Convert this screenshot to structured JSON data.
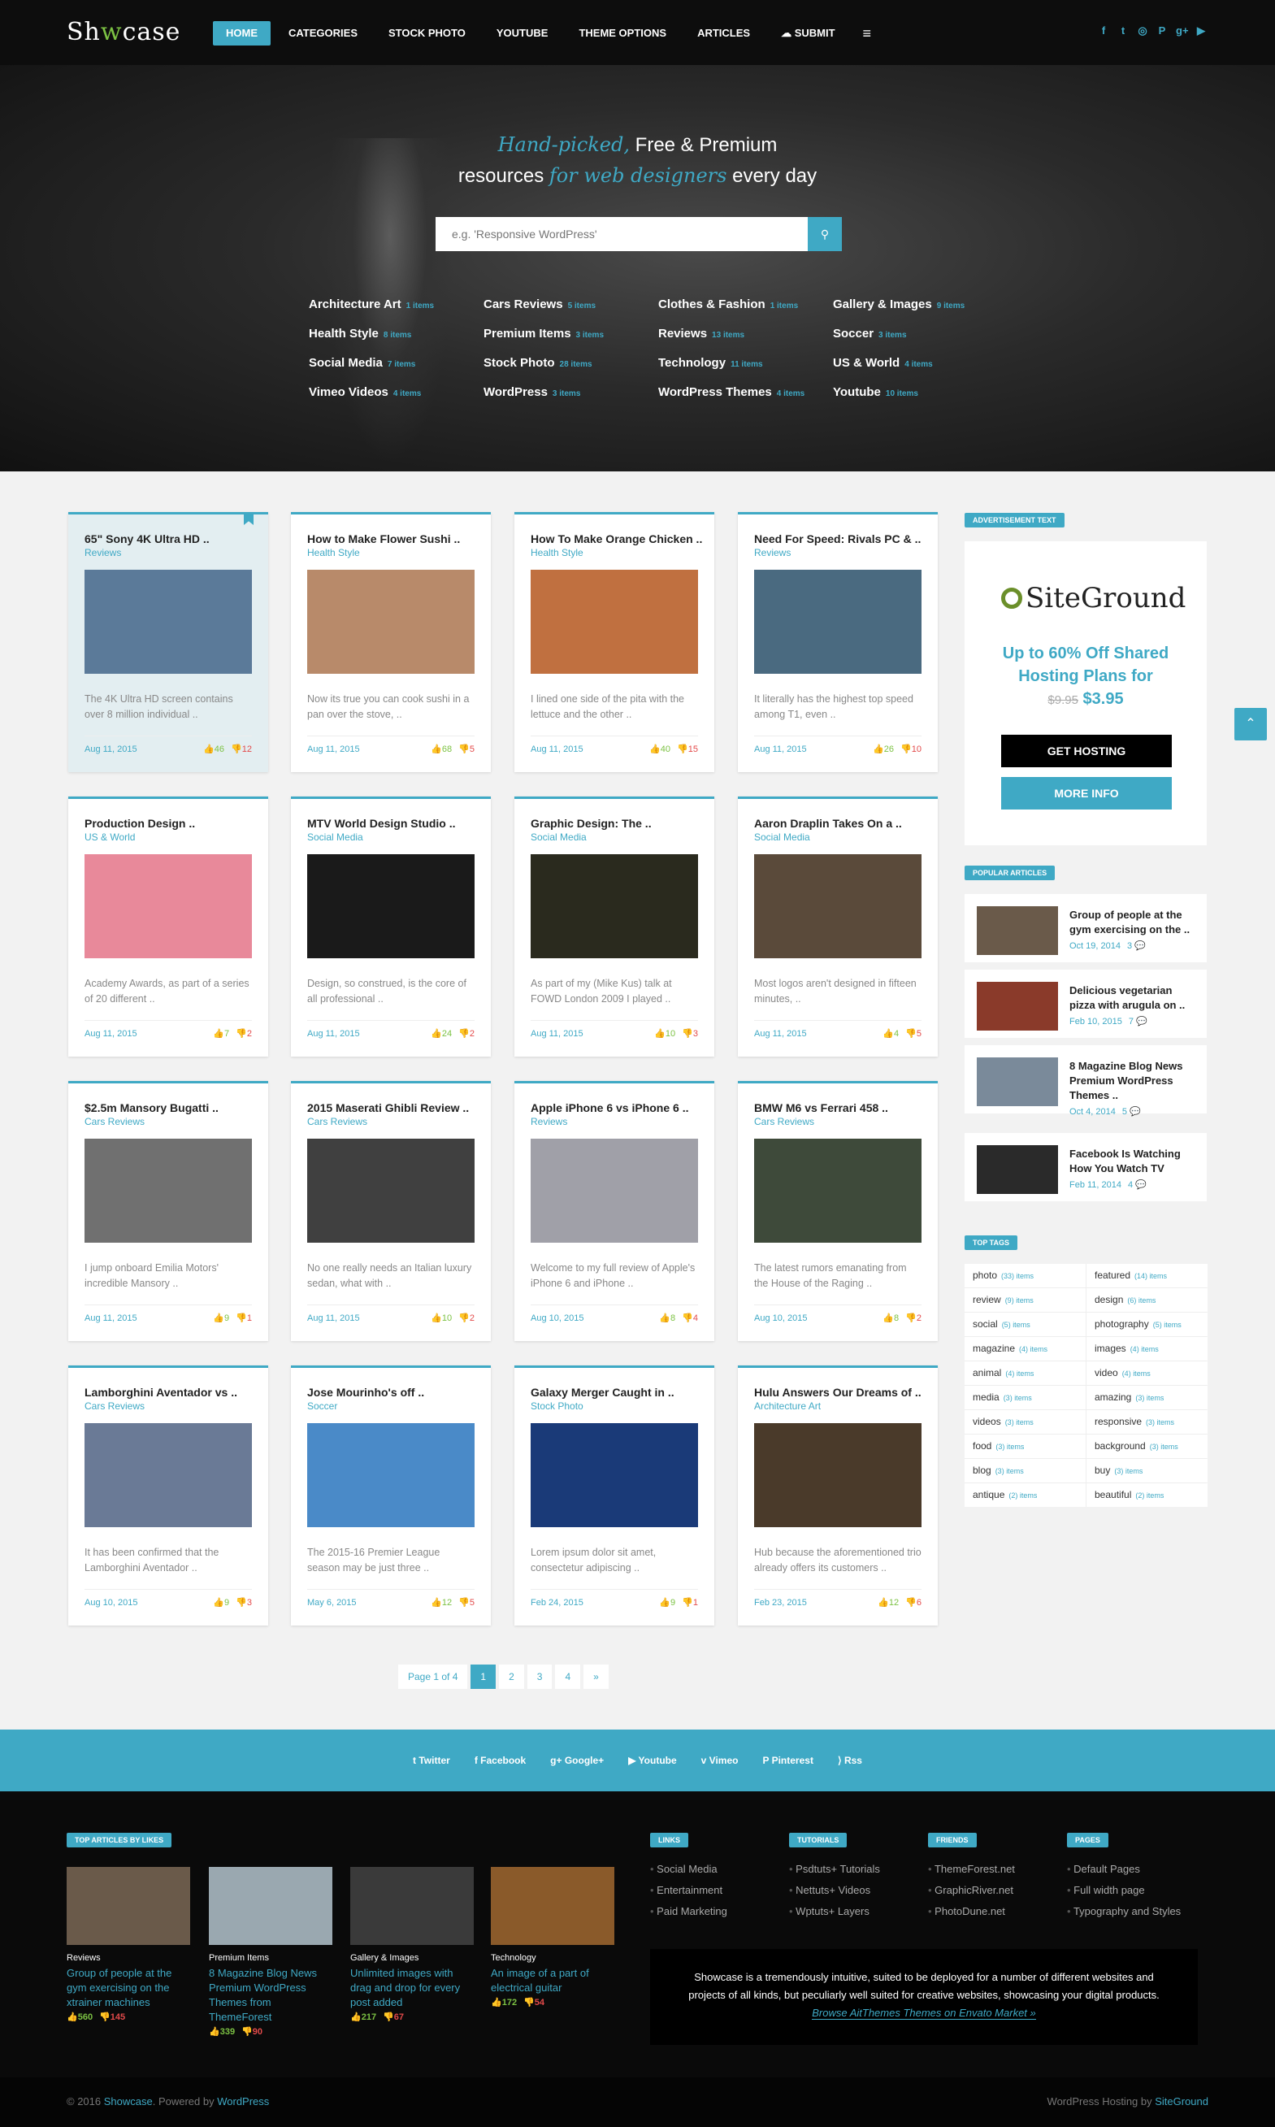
{
  "header": {
    "logo_pre": "Sh",
    "logo_w": "w",
    "logo_post": "case",
    "nav": [
      "HOME",
      "CATEGORIES",
      "STOCK PHOTO",
      "YOUTUBE",
      "THEME OPTIONS",
      "ARTICLES",
      "SUBMIT"
    ],
    "social_icons": [
      "facebook-icon",
      "twitter-icon",
      "instagram-icon",
      "pinterest-icon",
      "google-plus-icon",
      "youtube-icon"
    ]
  },
  "hero": {
    "line1_hl": "Hand-picked,",
    "line1": " Free & Premium",
    "line2_a": "resources ",
    "line2_hl": "for web designers",
    "line2_b": " every day",
    "search_placeholder": "e.g. 'Responsive WordPress'",
    "categories": [
      {
        "name": "Architecture Art",
        "count": "1 items"
      },
      {
        "name": "Cars Reviews",
        "count": "5 items"
      },
      {
        "name": "Clothes & Fashion",
        "count": "1 items"
      },
      {
        "name": "Gallery & Images",
        "count": "9 items"
      },
      {
        "name": "Health Style",
        "count": "8 items"
      },
      {
        "name": "Premium Items",
        "count": "3 items"
      },
      {
        "name": "Reviews",
        "count": "13 items"
      },
      {
        "name": "Soccer",
        "count": "3 items"
      },
      {
        "name": "Social Media",
        "count": "7 items"
      },
      {
        "name": "Stock Photo",
        "count": "28 items"
      },
      {
        "name": "Technology",
        "count": "11 items"
      },
      {
        "name": "US & World",
        "count": "4 items"
      },
      {
        "name": "Vimeo Videos",
        "count": "4 items"
      },
      {
        "name": "WordPress",
        "count": "3 items"
      },
      {
        "name": "WordPress Themes",
        "count": "4 items"
      },
      {
        "name": "Youtube",
        "count": "10 items"
      }
    ]
  },
  "posts": [
    {
      "title": "65\" Sony 4K Ultra HD ..",
      "cat": "Reviews",
      "excerpt": "The 4K Ultra HD screen contains over 8 million individual ..",
      "date": "Aug 11, 2015",
      "up": "46",
      "down": "12",
      "img": "#5b7a99"
    },
    {
      "title": "How to Make Flower Sushi ..",
      "cat": "Health Style",
      "excerpt": "Now its true you can cook sushi in a pan over the stove, ..",
      "date": "Aug 11, 2015",
      "up": "68",
      "down": "5",
      "img": "#b88a6a"
    },
    {
      "title": "How To Make Orange Chicken ..",
      "cat": "Health Style",
      "excerpt": "I lined one side of the pita with the lettuce and the other ..",
      "date": "Aug 11, 2015",
      "up": "40",
      "down": "15",
      "img": "#c07040"
    },
    {
      "title": "Need For Speed: Rivals PC & ..",
      "cat": "Reviews",
      "excerpt": "It literally has the highest top speed among T1, even ..",
      "date": "Aug 11, 2015",
      "up": "26",
      "down": "10",
      "img": "#4a6a80"
    },
    {
      "title": "Production Design ..",
      "cat": "US & World",
      "excerpt": "Academy Awards, as part of a series of 20 different ..",
      "date": "Aug 11, 2015",
      "up": "7",
      "down": "2",
      "img": "#e8899a"
    },
    {
      "title": "MTV World Design Studio ..",
      "cat": "Social Media",
      "excerpt": "Design, so construed, is the core of all professional ..",
      "date": "Aug 11, 2015",
      "up": "24",
      "down": "2",
      "img": "#1a1a1a"
    },
    {
      "title": "Graphic Design: The ..",
      "cat": "Social Media",
      "excerpt": "As part of my (Mike Kus) talk at FOWD London 2009 I played ..",
      "date": "Aug 11, 2015",
      "up": "10",
      "down": "3",
      "img": "#2a2a1e"
    },
    {
      "title": "Aaron Draplin Takes On a ..",
      "cat": "Social Media",
      "excerpt": "Most logos aren't designed in fifteen minutes, ..",
      "date": "Aug 11, 2015",
      "up": "4",
      "down": "5",
      "img": "#5a4a3a"
    },
    {
      "title": "$2.5m Mansory Bugatti ..",
      "cat": "Cars Reviews",
      "excerpt": "I jump onboard Emilia Motors' incredible Mansory ..",
      "date": "Aug 11, 2015",
      "up": "9",
      "down": "1",
      "img": "#707070"
    },
    {
      "title": "2015 Maserati Ghibli Review ..",
      "cat": "Cars Reviews",
      "excerpt": "No one really needs an Italian luxury sedan, what with ..",
      "date": "Aug 11, 2015",
      "up": "10",
      "down": "2",
      "img": "#404040"
    },
    {
      "title": "Apple iPhone 6 vs iPhone 6 ..",
      "cat": "Reviews",
      "excerpt": "Welcome to my full review of Apple's iPhone 6 and iPhone ..",
      "date": "Aug 10, 2015",
      "up": "8",
      "down": "4",
      "img": "#a0a0a8"
    },
    {
      "title": "BMW M6 vs Ferrari 458 ..",
      "cat": "Cars Reviews",
      "excerpt": "The latest rumors emanating from the House of the Raging ..",
      "date": "Aug 10, 2015",
      "up": "8",
      "down": "2",
      "img": "#3e4a3a"
    },
    {
      "title": "Lamborghini Aventador vs ..",
      "cat": "Cars Reviews",
      "excerpt": "It has been confirmed that the Lamborghini Aventador ..",
      "date": "Aug 10, 2015",
      "up": "9",
      "down": "3",
      "img": "#6a7a96"
    },
    {
      "title": "Jose Mourinho's off ..",
      "cat": "Soccer",
      "excerpt": "The 2015-16 Premier League season may be just three ..",
      "date": "May 6, 2015",
      "up": "12",
      "down": "5",
      "img": "#4a8ac8"
    },
    {
      "title": "Galaxy Merger Caught in ..",
      "cat": "Stock Photo",
      "excerpt": "Lorem ipsum dolor sit amet, consectetur adipiscing ..",
      "date": "Feb 24, 2015",
      "up": "9",
      "down": "1",
      "img": "#1a3a78"
    },
    {
      "title": "Hulu Answers Our Dreams of ..",
      "cat": "Architecture Art",
      "excerpt": "Hub because the aforementioned trio already offers its customers ..",
      "date": "Feb 23, 2015",
      "up": "12",
      "down": "6",
      "img": "#4a3a2a"
    }
  ],
  "pager": {
    "label": "Page 1 of 4",
    "pages": [
      "1",
      "2",
      "3",
      "4",
      "»"
    ]
  },
  "sidebar": {
    "ad_label": "ADVERTISEMENT TEXT",
    "ad_brand": "SiteGround",
    "ad_line1": "Up to 60% Off Shared",
    "ad_line2": "Hosting Plans for",
    "ad_old": "$9.95",
    "ad_new": "$3.95",
    "ad_btn1": "GET HOSTING",
    "ad_btn2": "MORE INFO",
    "popular_label": "POPULAR ARTICLES",
    "popular": [
      {
        "title": "Group of people at the gym exercising on the ..",
        "date": "Oct 19, 2014",
        "comments": "3",
        "img": "#6a5a4a"
      },
      {
        "title": "Delicious vegetarian pizza with arugula on ..",
        "date": "Feb 10, 2015",
        "comments": "7",
        "img": "#8a3a2a"
      },
      {
        "title": "8 Magazine Blog News Premium WordPress Themes ..",
        "date": "Oct 4, 2014",
        "comments": "5",
        "img": "#7a8a9a"
      },
      {
        "title": "Facebook Is Watching How You Watch TV",
        "date": "Feb 11, 2014",
        "comments": "4",
        "img": "#2a2a2a"
      }
    ],
    "tags_label": "TOP TAGS",
    "tags": [
      {
        "n": "photo",
        "c": "(33) items"
      },
      {
        "n": "featured",
        "c": "(14) items"
      },
      {
        "n": "review",
        "c": "(9) items"
      },
      {
        "n": "design",
        "c": "(6) items"
      },
      {
        "n": "social",
        "c": "(5) items"
      },
      {
        "n": "photography",
        "c": "(5) items"
      },
      {
        "n": "magazine",
        "c": "(4) items"
      },
      {
        "n": "images",
        "c": "(4) items"
      },
      {
        "n": "animal",
        "c": "(4) items"
      },
      {
        "n": "video",
        "c": "(4) items"
      },
      {
        "n": "media",
        "c": "(3) items"
      },
      {
        "n": "amazing",
        "c": "(3) items"
      },
      {
        "n": "videos",
        "c": "(3) items"
      },
      {
        "n": "responsive",
        "c": "(3) items"
      },
      {
        "n": "food",
        "c": "(3) items"
      },
      {
        "n": "background",
        "c": "(3) items"
      },
      {
        "n": "blog",
        "c": "(3) items"
      },
      {
        "n": "buy",
        "c": "(3) items"
      },
      {
        "n": "antique",
        "c": "(2) items"
      },
      {
        "n": "beautiful",
        "c": "(2) items"
      }
    ]
  },
  "social_bar": [
    "Twitter",
    "Facebook",
    "Google+",
    "Youtube",
    "Vimeo",
    "Pinterest",
    "Rss"
  ],
  "footer": {
    "top_label": "TOP ARTICLES BY LIKES",
    "top": [
      {
        "cat": "Reviews",
        "title": "Group of people at the gym exercising on the xtrainer machines",
        "up": "560",
        "down": "145",
        "img": "#6a5a4a"
      },
      {
        "cat": "Premium Items",
        "title": "8 Magazine Blog News Premium WordPress Themes from ThemeForest",
        "up": "339",
        "down": "90",
        "img": "#9aa8b0"
      },
      {
        "cat": "Gallery & Images",
        "title": "Unlimited images with drag and drop for every post added",
        "up": "217",
        "down": "67",
        "img": "#3a3a3a"
      },
      {
        "cat": "Technology",
        "title": "An image of a part of electrical guitar",
        "up": "172",
        "down": "54",
        "img": "#8a5a2a"
      }
    ],
    "cols": [
      {
        "label": "LINKS",
        "items": [
          "Social Media",
          "Entertainment",
          "Paid Marketing"
        ]
      },
      {
        "label": "TUTORIALS",
        "items": [
          "Psdtuts+ Tutorials",
          "Nettuts+ Videos",
          "Wptuts+ Layers"
        ]
      },
      {
        "label": "FRIENDS",
        "items": [
          "ThemeForest.net",
          "GraphicRiver.net",
          "PhotoDune.net"
        ]
      },
      {
        "label": "PAGES",
        "items": [
          "Default Pages",
          "Full width page",
          "Typography and Styles"
        ]
      }
    ],
    "about": "Showcase is a tremendously intuitive, suited to be deployed for a number of different websites and projects of all kinds, but peculiarly well suited for creative websites, showcasing your digital products.",
    "about_link": "Browse AitThemes Themes on Envato Market »",
    "copy_pre": "© 2016 ",
    "copy_brand": "Showcase",
    "copy_mid": ". Powered by ",
    "copy_wp": "WordPress",
    "host_pre": "WordPress Hosting by ",
    "host_brand": "SiteGround"
  },
  "colors": {
    "accent": "#3fa9c5",
    "up": "#7cc243",
    "down": "#e34a4a"
  }
}
